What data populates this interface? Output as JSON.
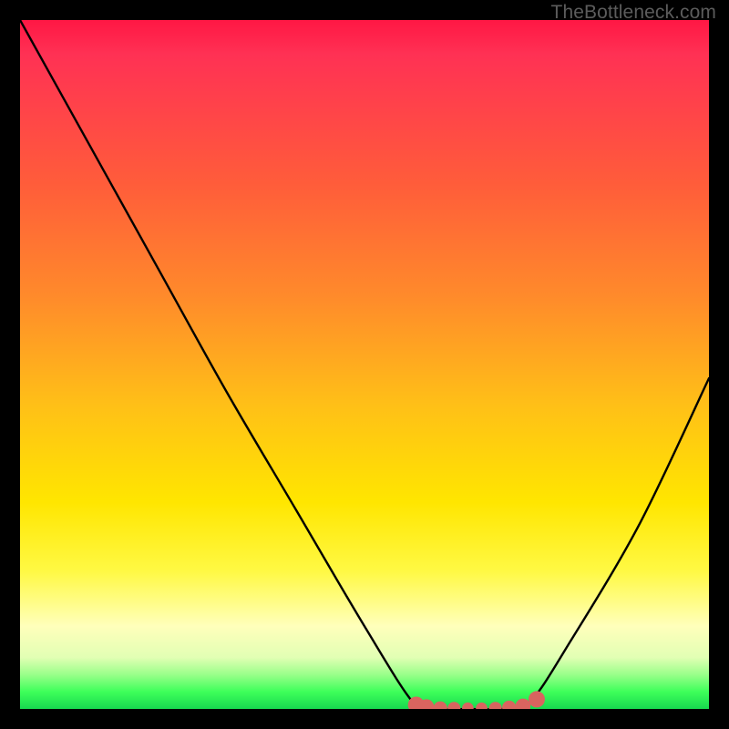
{
  "watermark": "TheBottleneck.com",
  "chart_data": {
    "type": "line",
    "title": "",
    "xlabel": "",
    "ylabel": "",
    "xlim": [
      0,
      100
    ],
    "ylim": [
      0,
      100
    ],
    "series": [
      {
        "name": "bottleneck-curve",
        "x": [
          0,
          10,
          20,
          30,
          40,
          50,
          57,
          60,
          65,
          70,
          74,
          80,
          90,
          100
        ],
        "y": [
          100,
          82,
          64,
          46,
          29,
          12,
          1,
          0,
          0,
          0,
          1,
          10,
          27,
          48
        ]
      }
    ],
    "markers": {
      "name": "optimal-range-dots",
      "color": "#d9645f",
      "x": [
        57.5,
        59,
        61,
        63,
        65,
        67,
        69,
        71,
        73,
        75
      ],
      "y": [
        0.6,
        0.3,
        0.1,
        0.1,
        0.1,
        0.1,
        0.1,
        0.2,
        0.4,
        1.4
      ]
    },
    "background_gradient": {
      "top": "#ff1744",
      "middle": "#ffe600",
      "bottom": "#17d84f"
    }
  }
}
